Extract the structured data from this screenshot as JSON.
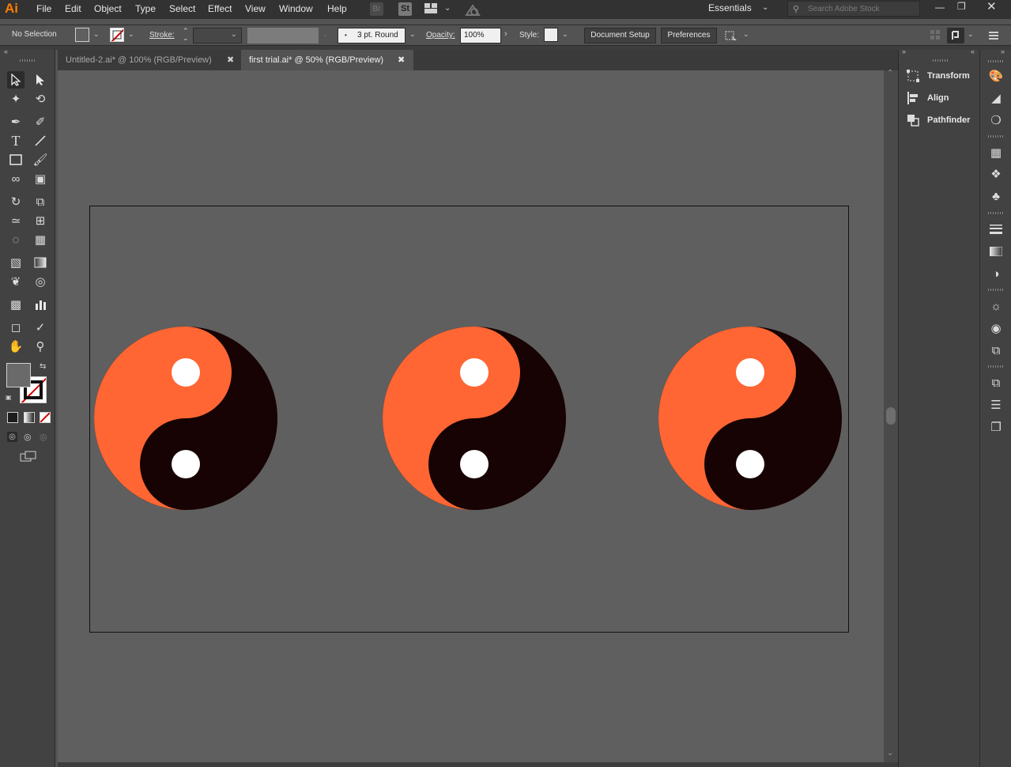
{
  "app": {
    "logo": "Ai",
    "menus": [
      "File",
      "Edit",
      "Object",
      "Type",
      "Select",
      "Effect",
      "View",
      "Window",
      "Help"
    ],
    "bridge_label": "Br",
    "stock_label": "St",
    "workspace": "Essentials",
    "search_placeholder": "Search Adobe Stock"
  },
  "control_bar": {
    "selection": "No Selection",
    "stroke_label": "Stroke:",
    "brush_value": "3 pt. Round",
    "opacity_label": "Opacity:",
    "opacity_value": "100%",
    "style_label": "Style:",
    "document_setup": "Document Setup",
    "preferences": "Preferences"
  },
  "tabs": [
    {
      "title": "Untitled-2.ai* @ 100% (RGB/Preview)",
      "active": false
    },
    {
      "title": "first trial.ai* @ 50% (RGB/Preview)",
      "active": true
    }
  ],
  "right_panel": {
    "items": [
      "Transform",
      "Align",
      "Pathfinder"
    ]
  },
  "colors": {
    "orange": "#ff6633",
    "dark": "#170303",
    "dot": "#ffffff",
    "canvas": "#5f5f5f",
    "artboard_border": "#111111"
  },
  "icons": {
    "tools": [
      "selection-icon",
      "direct-selection-icon",
      "magic-wand-icon",
      "lasso-icon",
      "pen-icon",
      "curvature-icon",
      "type-icon",
      "line-segment-icon",
      "rectangle-icon",
      "paintbrush-icon",
      "shaper-icon",
      "eraser-icon",
      "rotate-icon",
      "scale-icon",
      "warp-icon",
      "free-transform-icon",
      "shape-builder-icon",
      "perspective-grid-icon",
      "mesh-icon",
      "gradient-icon",
      "eyedropper-icon",
      "blend-icon",
      "symbol-sprayer-icon",
      "column-graph-icon",
      "artboard-icon",
      "slice-icon",
      "hand-icon",
      "zoom-icon"
    ]
  }
}
